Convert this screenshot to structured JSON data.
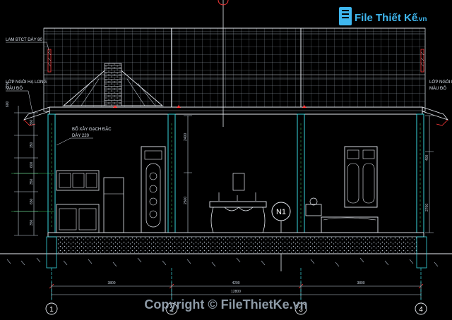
{
  "labels": {
    "roof_slab": "LAM BTCT DÀY 80",
    "roof_tile": [
      "LỚP NGÓI HẠ LONG",
      "MÀU ĐỎ"
    ],
    "wall": [
      "BỔ XÂY GẠCH ĐẶC",
      "DÀY 220"
    ],
    "section_tag": "N1"
  },
  "dimensions": {
    "top_left_levels": [
      "600",
      "250"
    ],
    "left_column": [
      "350",
      "350",
      "600",
      "350",
      "650",
      "350"
    ],
    "center_heights": [
      "2400",
      "2500"
    ],
    "right_heights": [
      "400",
      "2700"
    ],
    "bottom_spans": [
      "3800",
      "4200",
      "3800"
    ],
    "bottom_total": "12800"
  },
  "axes": [
    "1",
    "2",
    "3",
    "4"
  ],
  "watermark": {
    "brand": "File Thiết Kế",
    "brand_suffix": ".vn",
    "copyright": "Copyright © FileThietKe.vn"
  },
  "colors": {
    "background": "#000000",
    "line_white": "#e8ecf2",
    "line_cyan": "#38d9e0",
    "line_red": "#ff3a3a",
    "line_grey": "#8f98a3",
    "fill_green": "#3fd36b",
    "brand_blue": "#3fb7ef"
  }
}
